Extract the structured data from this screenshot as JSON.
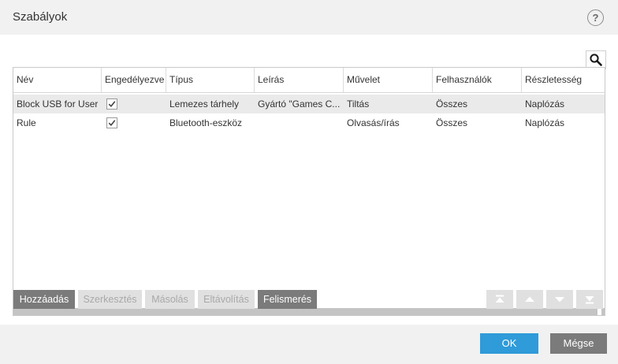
{
  "dialog": {
    "title": "Szabályok",
    "help_label": "?"
  },
  "table": {
    "columns": [
      "Név",
      "Engedélyezve",
      "Típus",
      "Leírás",
      "Művelet",
      "Felhasználók",
      "Részletesség"
    ],
    "rows": [
      {
        "name": "Block USB for User",
        "enabled": true,
        "type": "Lemezes tárhely",
        "description": "Gyártó \"Games C...",
        "action": "Tiltás",
        "users": "Összes",
        "verbosity": "Naplózás",
        "selected": true
      },
      {
        "name": "Rule",
        "enabled": true,
        "type": "Bluetooth-eszköz",
        "description": "",
        "action": "Olvasás/írás",
        "users": "Összes",
        "verbosity": "Naplózás",
        "selected": false
      }
    ]
  },
  "actions": {
    "add": "Hozzáadás",
    "edit": "Szerkesztés",
    "copy": "Másolás",
    "remove": "Eltávolítás",
    "detect": "Felismerés"
  },
  "order_buttons": {
    "top_icon": "move-to-top-icon",
    "up_icon": "move-up-icon",
    "down_icon": "move-down-icon",
    "bottom_icon": "move-to-bottom-icon"
  },
  "footer": {
    "ok": "OK",
    "cancel": "Mégse"
  },
  "colors": {
    "accent": "#2f9bd8",
    "button_active": "#7b7b7b",
    "button_disabled": "#e0e0e0",
    "selected_row": "#eaeaea"
  }
}
